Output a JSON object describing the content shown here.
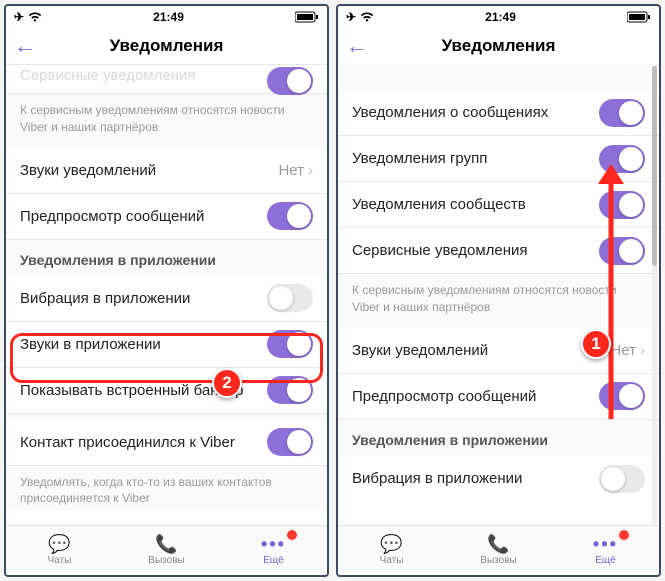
{
  "status": {
    "time": "21:49"
  },
  "nav": {
    "title": "Уведомления"
  },
  "left": {
    "partial_top_label": "Сервисные уведомления",
    "desc1": "К сервисным уведомлениям относятся новости Viber и наших партнёров",
    "sounds_label": "Звуки уведомлений",
    "sounds_value": "Нет",
    "preview_label": "Предпросмотр сообщений",
    "section_inapp": "Уведомления в приложении",
    "vibration_label": "Вибрация в приложении",
    "insounds_label": "Звуки в приложении",
    "builtin_label": "Показывать встроенный баннер",
    "joined_label": "Контакт присоединился к Viber",
    "desc2": "Уведомлять, когда кто-то из ваших контактов присоединяется к Viber"
  },
  "right": {
    "msg_label": "Уведомления о сообщениях",
    "groups_label": "Уведомления групп",
    "comm_label": "Уведомления сообществ",
    "service_label": "Сервисные уведомления",
    "desc1": "К сервисным уведомлениям относятся новости Viber и наших партнёров",
    "sounds_label": "Звуки уведомлений",
    "sounds_value": "Нет",
    "preview_label": "Предпросмотр сообщений",
    "section_inapp": "Уведомления в приложении",
    "vibration_label": "Вибрация в приложении"
  },
  "tabs": {
    "chats": "Чаты",
    "calls": "Вызовы",
    "more": "Ещё"
  },
  "steps": {
    "one": "1",
    "two": "2"
  }
}
